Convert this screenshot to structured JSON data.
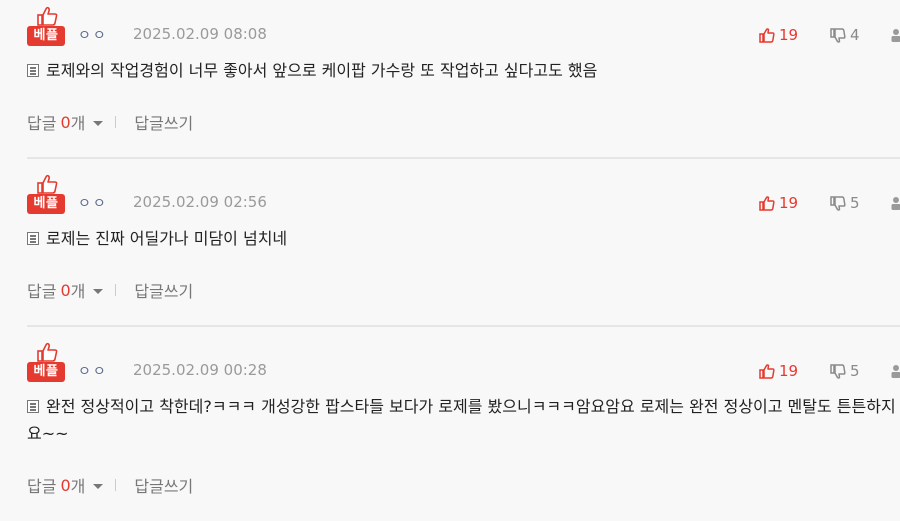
{
  "comments": [
    {
      "badge": "베플",
      "nickname": "ㅇㅇ",
      "date": "2025.02.09 08:08",
      "likes": "19",
      "dislikes": "4",
      "body": "로제와의 작업경험이 너무 좋아서 앞으로 케이팝 가수랑 또 작업하고 싶다고도 했음",
      "reply_label": "답글",
      "reply_count": "0",
      "reply_unit": "개",
      "write_reply_label": "답글쓰기"
    },
    {
      "badge": "베플",
      "nickname": "ㅇㅇ",
      "date": "2025.02.09 02:56",
      "likes": "19",
      "dislikes": "5",
      "body": "로제는 진짜 어딜가나 미담이 넘치네",
      "reply_label": "답글",
      "reply_count": "0",
      "reply_unit": "개",
      "write_reply_label": "답글쓰기"
    },
    {
      "badge": "베플",
      "nickname": "ㅇㅇ",
      "date": "2025.02.09 00:28",
      "likes": "19",
      "dislikes": "5",
      "body": "완전 정상적이고 착한데?ㅋㅋㅋ 개성강한 팝스타들 보다가 로제를 봤으니ㅋㅋㅋ암요암요 로제는 완전 정상이고 멘탈도 튼튼하지요~~",
      "reply_label": "답글",
      "reply_count": "0",
      "reply_unit": "개",
      "write_reply_label": "답글쓰기"
    }
  ],
  "colors": {
    "accent_red": "#e53a2f",
    "nickname_blue": "#5b6b8e",
    "muted_gray": "#9a9a9a"
  },
  "icons": {
    "best": "thumbs-up-icon",
    "like": "thumbs-up-outline-icon",
    "dislike": "thumbs-down-outline-icon",
    "body": "document-icon",
    "more": "user-icon"
  }
}
